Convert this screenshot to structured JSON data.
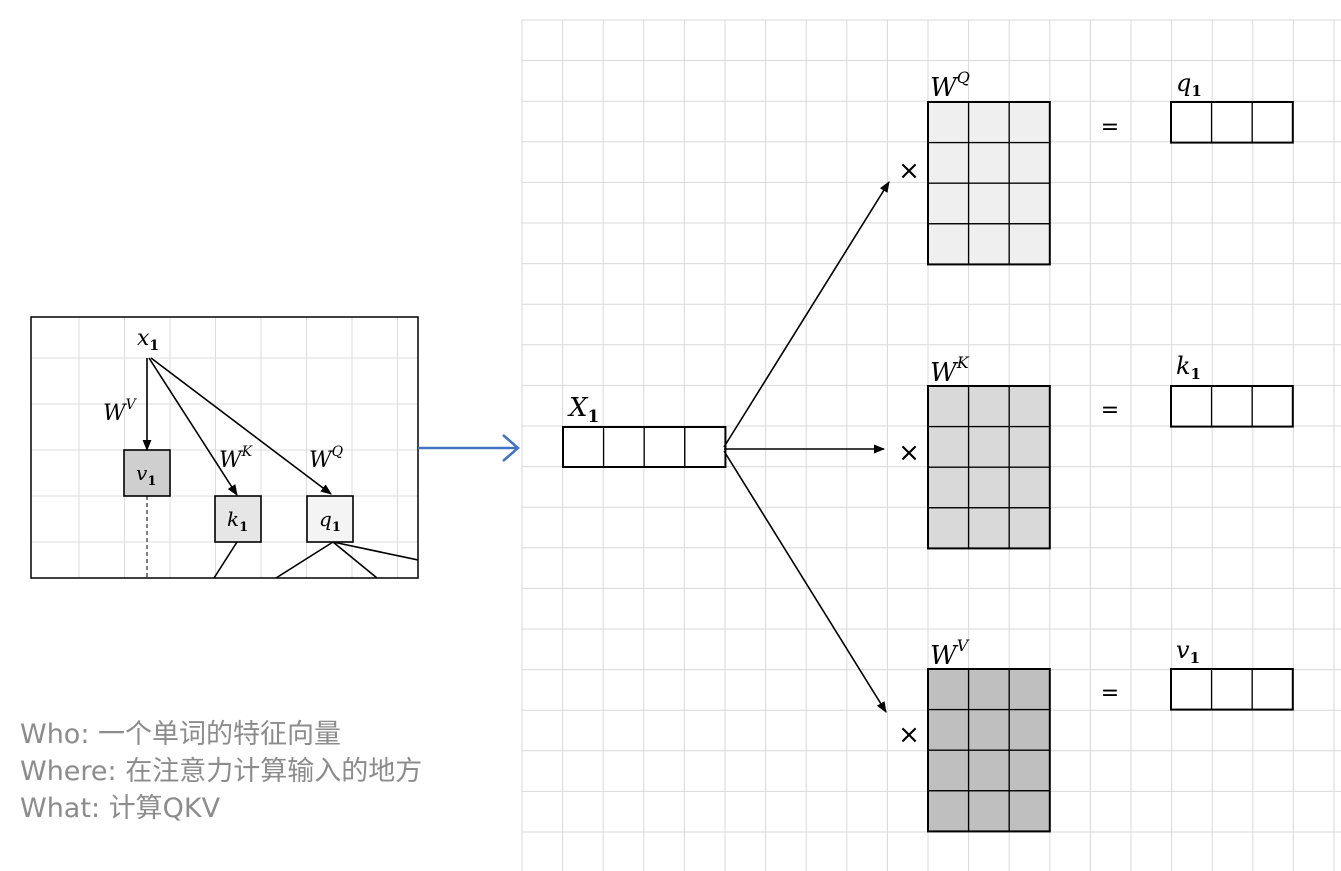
{
  "inset": {
    "x_label": "x",
    "x_sub": "1",
    "edge_labels": {
      "wv": "W",
      "wv_sup": "V",
      "wk": "W",
      "wk_sup": "K",
      "wq": "W",
      "wq_sup": "Q"
    },
    "nodes": [
      {
        "id": "v",
        "label": "v",
        "sub": "1",
        "fill": "#cfcfcf"
      },
      {
        "id": "k",
        "label": "k",
        "sub": "1",
        "fill": "#e6e6e6"
      },
      {
        "id": "q",
        "label": "q",
        "sub": "1",
        "fill": "#f4f4f4"
      }
    ]
  },
  "arrow_color": "#4472c4",
  "input_vector": {
    "label": "X",
    "sub": "1",
    "cells": 4
  },
  "projections": [
    {
      "id": "q",
      "weight": "W",
      "weight_sup": "Q",
      "weight_fill": "#efefef",
      "times": "×",
      "equals": "=",
      "out": "q",
      "out_sub": "1",
      "out_cells": 3
    },
    {
      "id": "k",
      "weight": "W",
      "weight_sup": "K",
      "weight_fill": "#d9d9d9",
      "times": "×",
      "equals": "=",
      "out": "k",
      "out_sub": "1",
      "out_cells": 3
    },
    {
      "id": "v",
      "weight": "W",
      "weight_sup": "V",
      "weight_fill": "#bfbfbf",
      "times": "×",
      "equals": "=",
      "out": "v",
      "out_sub": "1",
      "out_cells": 3
    }
  ],
  "description": {
    "who": "Who: 一个单词的特征向量",
    "where": "Where: 在注意力计算输入的地方",
    "what": "What: 计算QKV"
  }
}
